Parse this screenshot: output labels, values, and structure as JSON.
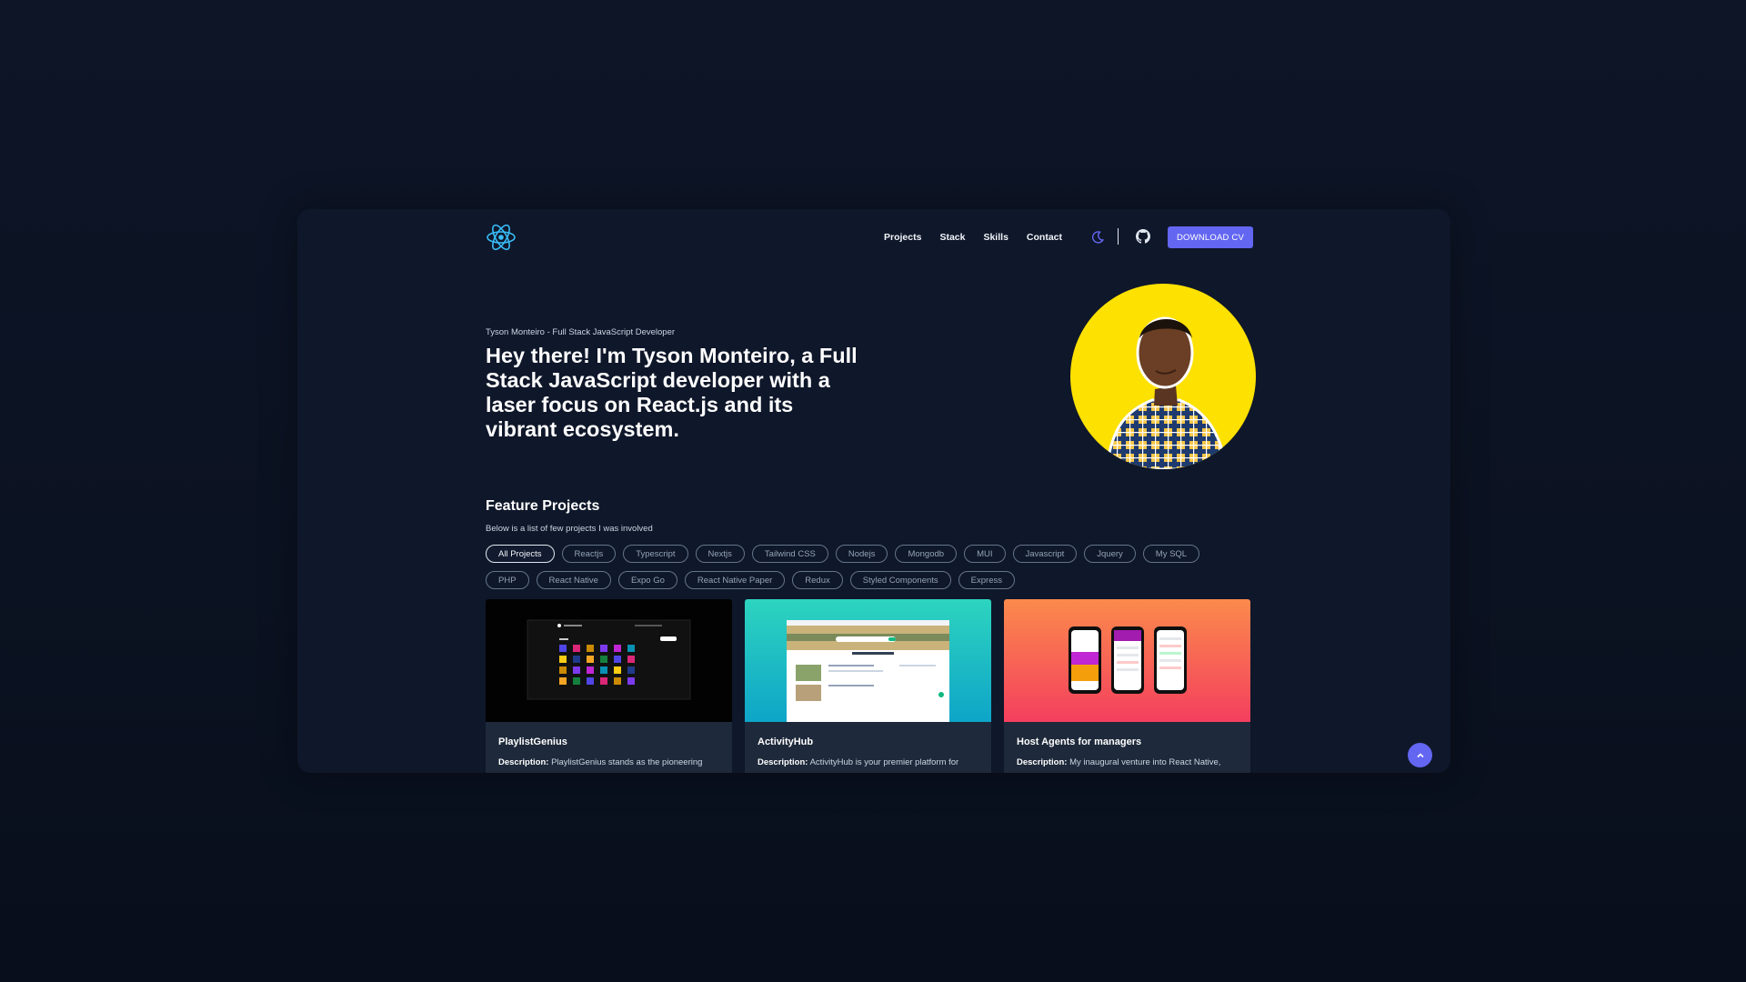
{
  "nav": {
    "links": [
      "Projects",
      "Stack",
      "Skills",
      "Contact"
    ],
    "cv_label": "DOWNLOAD CV"
  },
  "hero": {
    "subtitle": "Tyson Monteiro - Full Stack JavaScript Developer",
    "title": "Hey there! I'm Tyson Monteiro, a Full Stack JavaScript developer with a laser focus on React.js and its vibrant ecosystem."
  },
  "projects": {
    "title": "Feature Projects",
    "subtitle": "Below is a list of few projects I was involved",
    "filters_row1": [
      "All Projects",
      "Reactjs",
      "Typescript",
      "Nextjs",
      "Tailwind CSS",
      "Nodejs",
      "Mongodb",
      "MUI",
      "Javascript",
      "Jquery",
      "My SQL"
    ],
    "filters_row2": [
      "PHP",
      "React Native",
      "Expo Go",
      "React Native Paper",
      "Redux",
      "Styled Components",
      "Express"
    ],
    "active_filter": "All Projects",
    "cards": [
      {
        "title": "PlaylistGenius",
        "desc_label": "Description:",
        "desc": "PlaylistGenius stands as the pioneering"
      },
      {
        "title": "ActivityHub",
        "desc_label": "Description:",
        "desc": "ActivityHub is your premier platform for"
      },
      {
        "title": "Host Agents for managers",
        "desc_label": "Description:",
        "desc": "My inaugural venture into React Native,"
      }
    ]
  },
  "colors": {
    "accent": "#6366f1",
    "background": "#0f172a",
    "card": "#1e293b",
    "avatar_bg": "#fde100"
  },
  "icons": {
    "logo": "react-atom-icon",
    "theme": "moon-icon",
    "github": "github-icon",
    "scroll_top": "chevron-up-icon"
  }
}
